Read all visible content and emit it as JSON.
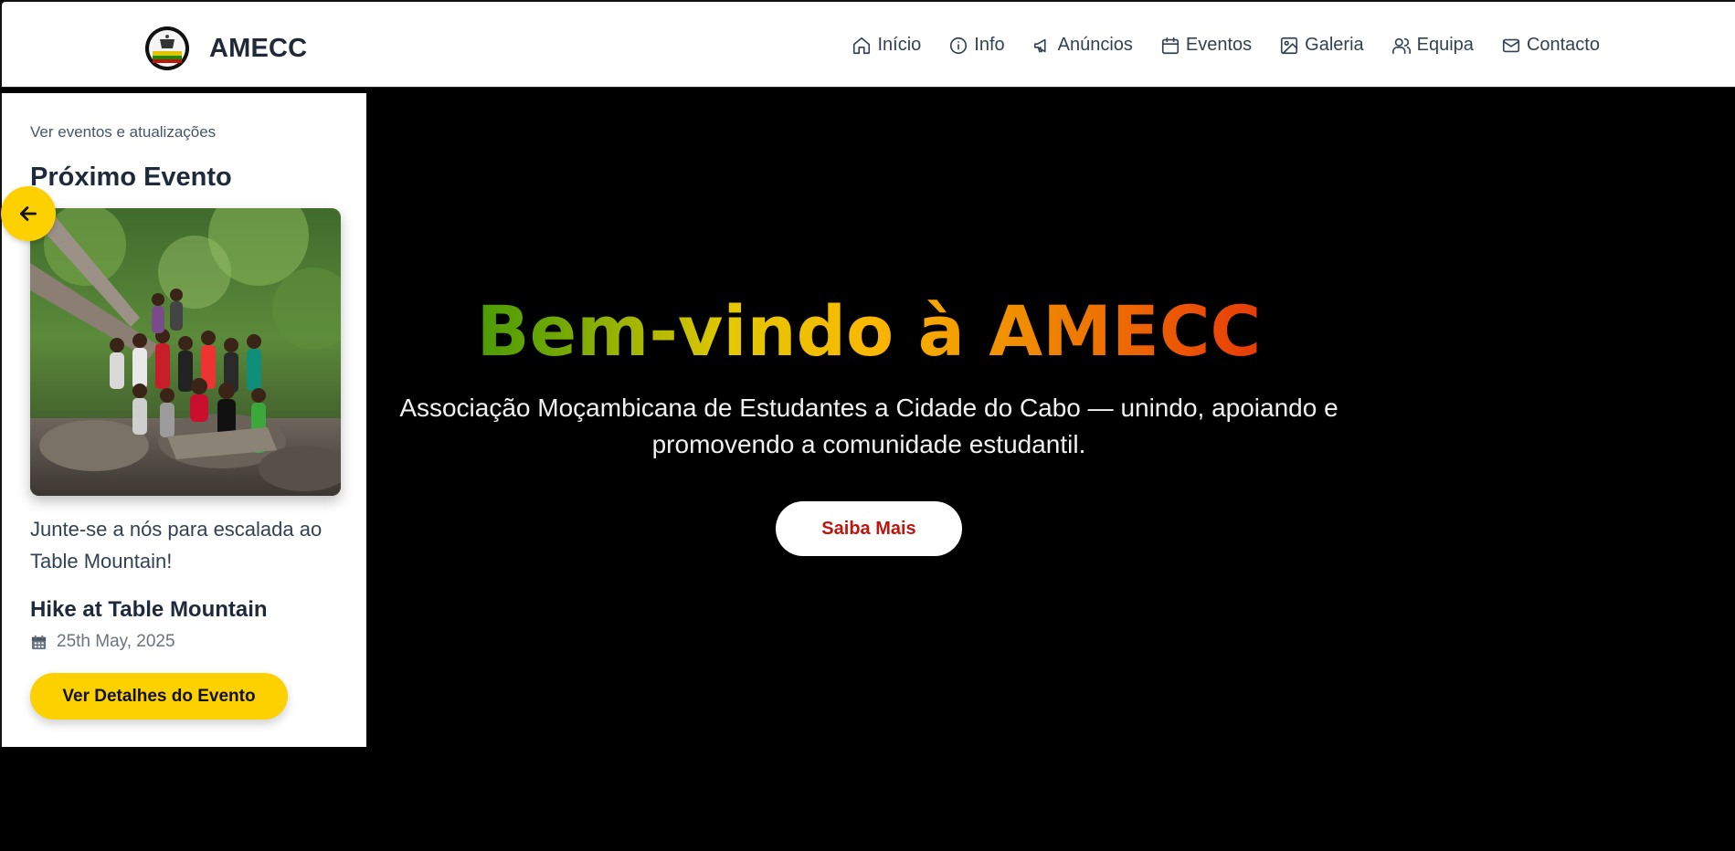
{
  "header": {
    "brand_name": "AMECC",
    "nav": [
      {
        "label": "Início",
        "icon": "home-icon"
      },
      {
        "label": "Info",
        "icon": "info-icon"
      },
      {
        "label": "Anúncios",
        "icon": "megaphone-icon"
      },
      {
        "label": "Eventos",
        "icon": "calendar-icon"
      },
      {
        "label": "Galeria",
        "icon": "image-icon"
      },
      {
        "label": "Equipa",
        "icon": "users-icon"
      },
      {
        "label": "Contacto",
        "icon": "mail-icon"
      }
    ]
  },
  "event_panel": {
    "kicker": "Ver eventos e atualizações",
    "title": "Próximo Evento",
    "description": "Junte-se a nós para escalada ao Table Mountain!",
    "event_name": "Hike at Table Mountain",
    "event_date": "25th May, 2025",
    "details_button": "Ver Detalhes do Evento",
    "back_icon": "arrow-left-icon"
  },
  "hero": {
    "title": "Bem-vindo à AMECC",
    "subtitle": "Associação Moçambicana de Estudantes a Cidade do Cabo — unindo, apoiando e promovendo a comunidade estudantil.",
    "cta_label": "Saiba Mais"
  },
  "colors": {
    "accent_yellow": "#fdd000",
    "cta_text_red": "#c0140c",
    "hero_background": "#000000",
    "gradient_start": "#1a8a06",
    "gradient_end": "#d81d0a"
  }
}
